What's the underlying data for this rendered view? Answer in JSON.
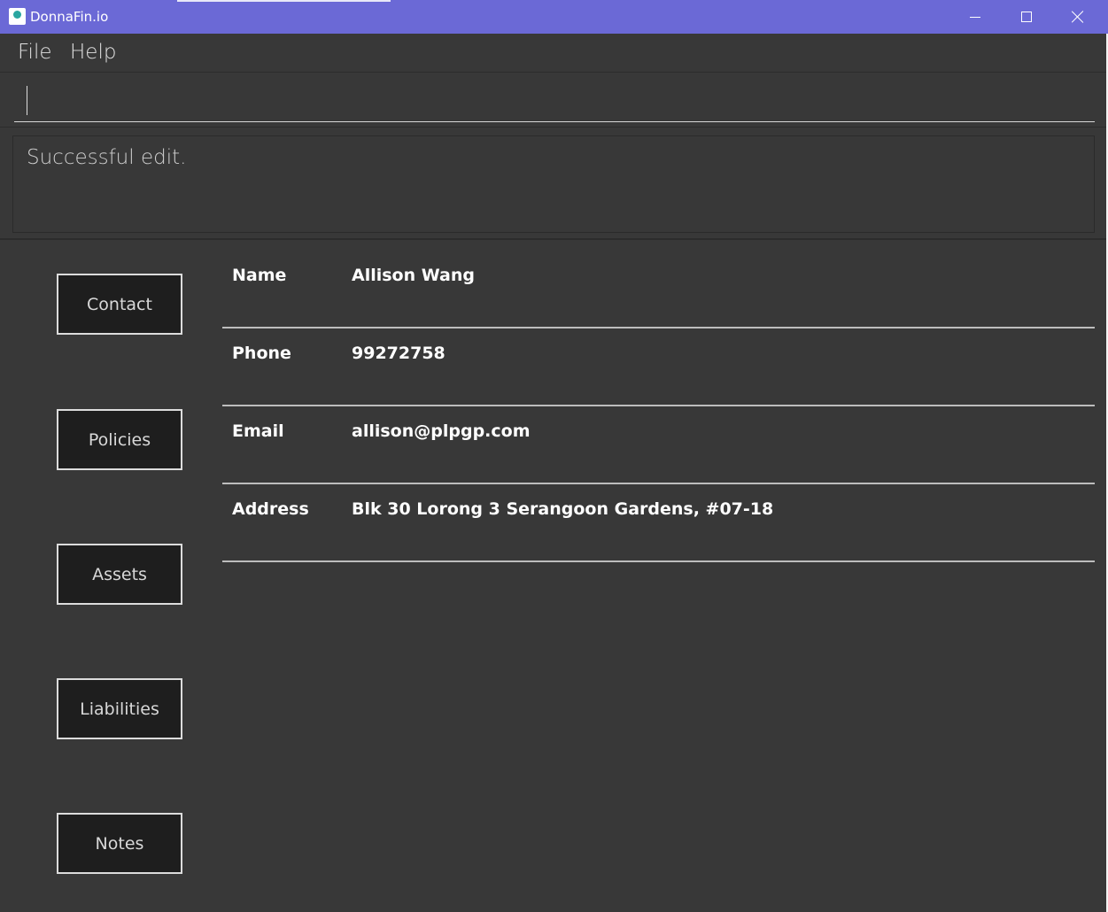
{
  "window": {
    "title": "DonnaFin.io",
    "icon": "donnafin-app-icon",
    "controls": [
      "minimize-icon",
      "maximize-icon",
      "close-icon"
    ],
    "accent_color": "#6b69d6"
  },
  "menu": {
    "file_label": "File",
    "help_label": "Help"
  },
  "command": {
    "value": "",
    "placeholder": ""
  },
  "result": {
    "message": "Successful edit."
  },
  "nav": {
    "contact_label": "Contact",
    "policies_label": "Policies",
    "assets_label": "Assets",
    "liabilities_label": "Liabilities",
    "notes_label": "Notes"
  },
  "contact": {
    "fields": [
      {
        "label": "Name",
        "value": "Allison Wang"
      },
      {
        "label": "Phone",
        "value": "99272758"
      },
      {
        "label": "Email",
        "value": "allison@plpgp.com"
      },
      {
        "label": "Address",
        "value": "Blk 30 Lorong 3 Serangoon Gardens, #07-18"
      }
    ]
  }
}
